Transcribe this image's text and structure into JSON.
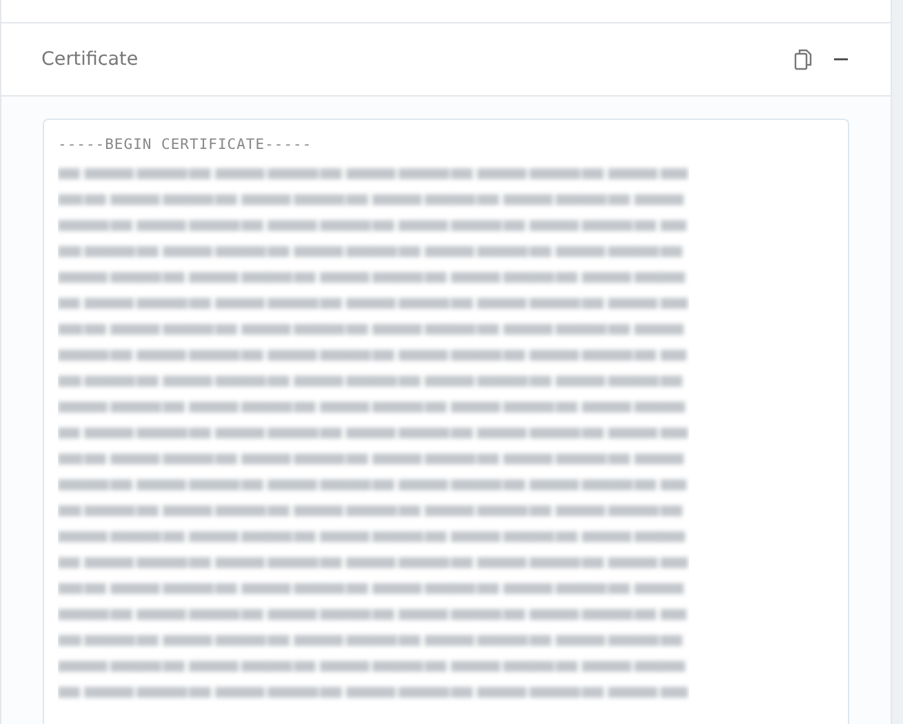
{
  "panel": {
    "title": "Certificate",
    "expanded": true
  },
  "certificate": {
    "first_line": "-----BEGIN CERTIFICATE-----"
  }
}
